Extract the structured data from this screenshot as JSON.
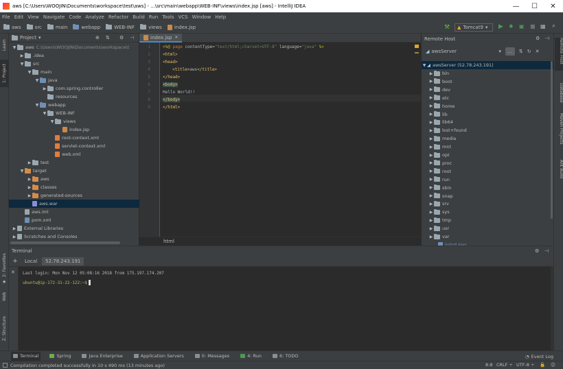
{
  "window": {
    "title": "aws [C:\\Users\\WOOJIN\\Documents\\workspace\\test\\aws] - ...\\src\\main\\webapp\\WEB-INF\\views\\index.jsp [aws] - IntelliJ IDEA",
    "minimize": "—",
    "maximize": "☐",
    "close": "✕"
  },
  "menu": [
    "File",
    "Edit",
    "View",
    "Navigate",
    "Code",
    "Analyze",
    "Refactor",
    "Build",
    "Run",
    "Tools",
    "VCS",
    "Window",
    "Help"
  ],
  "breadcrumbs": [
    "aws",
    "src",
    "main",
    "webapp",
    "WEB-INF",
    "views",
    "index.jsp"
  ],
  "run_config": "Tomcat9",
  "left_strip": {
    "learn": "Learn",
    "project": "1: Project",
    "favorites": "2: Favorites",
    "web": "Web",
    "structure": "Z: Structure"
  },
  "right_strip": {
    "remote_host": "Remote Host",
    "database": "Database",
    "maven": "Maven Projects",
    "ant": "Ant Build"
  },
  "project": {
    "title": "Project",
    "tree": [
      {
        "label": "aws",
        "suffix": "C:\\Users\\WOOJIN\\Documents\\workspace\\t",
        "indent": 0,
        "open": true,
        "icon": "folder-gray"
      },
      {
        "label": ".idea",
        "indent": 1,
        "open": false,
        "icon": "folder-gray"
      },
      {
        "label": "src",
        "indent": 1,
        "open": true,
        "icon": "folder-gray"
      },
      {
        "label": "main",
        "indent": 2,
        "open": true,
        "icon": "folder-gray"
      },
      {
        "label": "java",
        "indent": 3,
        "open": true,
        "icon": "folder-blue"
      },
      {
        "label": "com.spring.controller",
        "indent": 4,
        "open": false,
        "icon": "folder-gray"
      },
      {
        "label": "resources",
        "indent": 4,
        "leaf": true,
        "icon": "folder-gray"
      },
      {
        "label": "webapp",
        "indent": 3,
        "open": true,
        "icon": "folder-blue"
      },
      {
        "label": "WEB-INF",
        "indent": 4,
        "open": true,
        "icon": "folder-gray"
      },
      {
        "label": "views",
        "indent": 5,
        "open": true,
        "icon": "folder-gray"
      },
      {
        "label": "index.jsp",
        "indent": 6,
        "leaf": true,
        "icon": "jsp-file"
      },
      {
        "label": "root-context.xml",
        "indent": 5,
        "leaf": true,
        "icon": "xml-file"
      },
      {
        "label": "servlet-context.xml",
        "indent": 5,
        "leaf": true,
        "icon": "xml-file"
      },
      {
        "label": "web.xml",
        "indent": 5,
        "leaf": true,
        "icon": "xml-file"
      },
      {
        "label": "test",
        "indent": 2,
        "open": false,
        "icon": "folder-gray"
      },
      {
        "label": "target",
        "indent": 1,
        "open": true,
        "icon": "folder-brown"
      },
      {
        "label": "aws",
        "indent": 2,
        "open": false,
        "icon": "folder-brown"
      },
      {
        "label": "classes",
        "indent": 2,
        "open": false,
        "icon": "folder-brown"
      },
      {
        "label": "generated-sources",
        "indent": 2,
        "open": false,
        "icon": "folder-brown"
      },
      {
        "label": "aws.war",
        "indent": 2,
        "leaf": true,
        "icon": "war-file",
        "selected": true
      },
      {
        "label": "aws.iml",
        "indent": 1,
        "leaf": true,
        "icon": "iml-file"
      },
      {
        "label": "pom.xml",
        "indent": 1,
        "leaf": true,
        "icon": "maven-file"
      },
      {
        "label": "External Libraries",
        "indent": 0,
        "open": false,
        "icon": "library"
      },
      {
        "label": "Scratches and Consoles",
        "indent": 0,
        "open": false,
        "icon": "scratch"
      }
    ]
  },
  "editor": {
    "tab": "index.jsp",
    "footer": "html",
    "lines": [
      "1",
      "2",
      "3",
      "4",
      "5",
      "6",
      "7",
      "8",
      "9"
    ]
  },
  "code": {
    "l1a": "<%@ ",
    "l1b": "page ",
    "l1c": "contentType=",
    "l1d": "\"text/html;charset=UTF-8\"",
    "l1e": " language=",
    "l1f": "\"java\"",
    "l1g": " %>",
    "l2": "<html>",
    "l3": "<head>",
    "l4a": "<title>",
    "l4b": "aws",
    "l4c": "</title>",
    "l5": "</head>",
    "l6": "<body>",
    "l7": "Hello World!!",
    "l8": "</body>",
    "l9": "</html>"
  },
  "remote": {
    "title": "Remote Host",
    "server": "awsServer",
    "root": "awsServer (52.78.243.191)",
    "dirs": [
      "bin",
      "boot",
      "dev",
      "etc",
      "home",
      "lib",
      "lib64",
      "lost+found",
      "media",
      "mnt",
      "opt",
      "proc",
      "root",
      "run",
      "sbin",
      "snap",
      "srv",
      "sys",
      "tmp",
      "usr",
      "var"
    ],
    "file": "initrd.img"
  },
  "terminal": {
    "title": "Terminal",
    "tabs": [
      "Local",
      "52.78.243.191"
    ],
    "login": "Last login: Mon Nov 12 05:08:16 2018 from 175.197.174.207",
    "prompt": "ubuntu@ip-172-31-22-122:~$"
  },
  "bottom_tabs": [
    "Terminal",
    "Spring",
    "Java Enterprise",
    "Application Servers",
    "0: Messages",
    "4: Run",
    "6: TODO"
  ],
  "event_log": "Event Log",
  "status": {
    "message": "Compilation completed successfully in 10 s 490 ms (13 minutes ago)",
    "position": "8:8",
    "line_sep": "CRLF ÷",
    "encoding": "UTF-8 ÷"
  },
  "colors": {
    "accent": "#4a88c7",
    "selection": "#0d293e",
    "prompt": "#b5bd68"
  }
}
